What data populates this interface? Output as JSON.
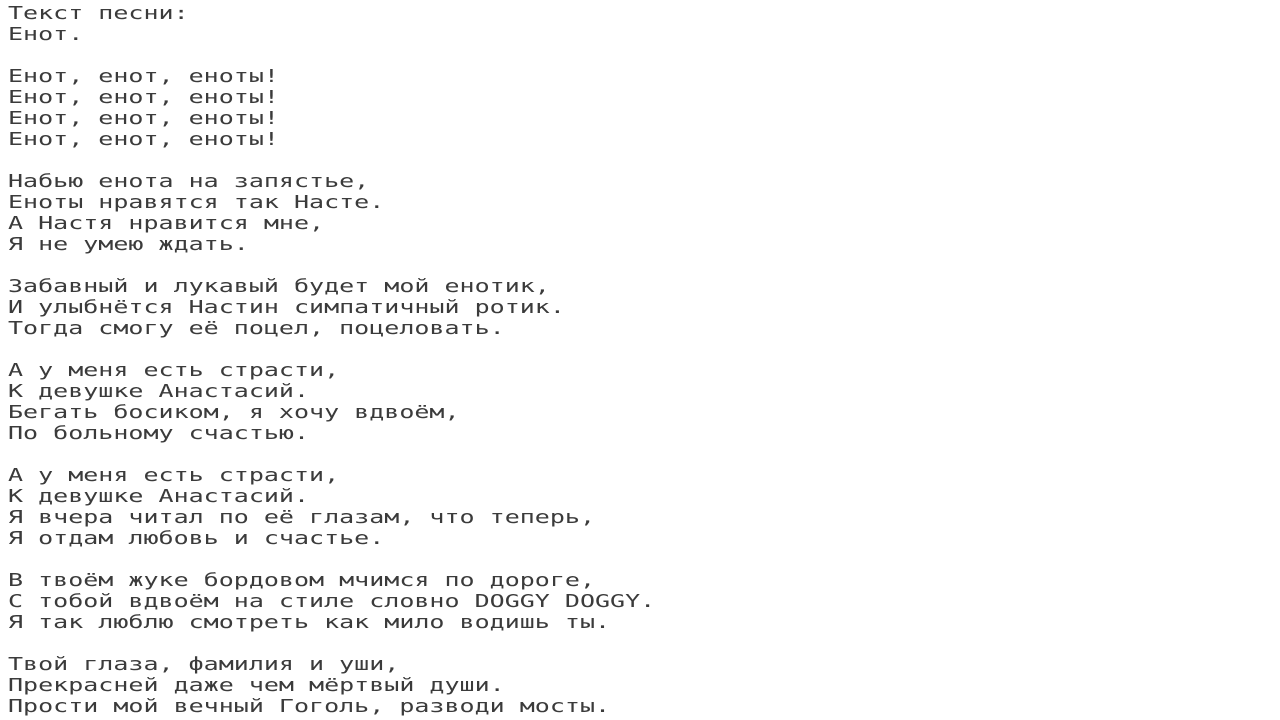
{
  "document": {
    "type": "plain-text-lyrics",
    "background_color": "#ffffff",
    "text_color": "#3b3b3b",
    "heading": "Текст песни:",
    "lines": [
      "Текст песни:",
      "Енот.",
      "",
      "Енот, енот, еноты!",
      "Енот, енот, еноты!",
      "Енот, енот, еноты!",
      "Енот, енот, еноты!",
      "",
      "Набью енота на запястье,",
      "Еноты нравятся так Насте.",
      "А Настя нравится мне,",
      "Я не умею ждать.",
      "",
      "Забавный и лукавый будет мой енотик,",
      "И улыбнётся Настин симпатичный ротик.",
      "Тогда смогу её поцел, поцеловать.",
      "",
      "А у меня есть страсти,",
      "К девушке Анастасий.",
      "Бегать босиком, я хочу вдвоём,",
      "По больному счастью.",
      "",
      "А у меня есть страсти,",
      "К девушке Анастасий.",
      "Я вчера читал по её глазам, что теперь,",
      "Я отдам любовь и счастье.",
      "",
      "В твоём жуке бордовом мчимся по дороге,",
      "С тобой вдвоём на стиле словно DOGGY DOGGY.",
      "Я так люблю смотреть как мило водишь ты.",
      "",
      "Твой глаза, фамилия и уши,",
      "Прекрасней даже чем мёртвый души.",
      "Прости мой вечный Гоголь, разводи мосты."
    ]
  }
}
